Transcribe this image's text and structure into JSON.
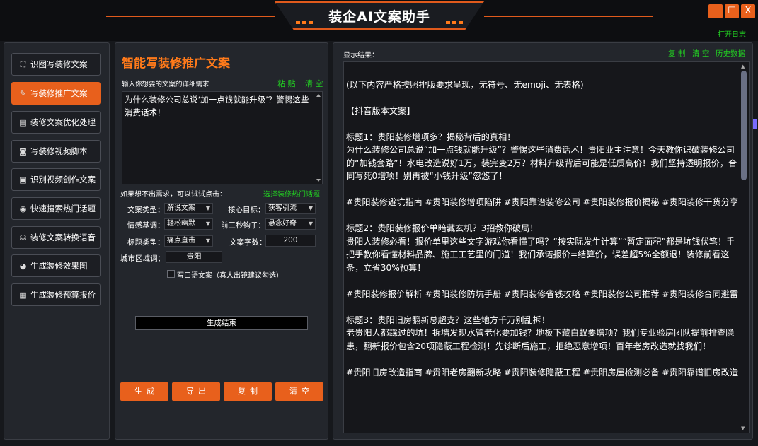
{
  "app": {
    "title": "装企AI文案助手",
    "open_log": "打开日志",
    "window_buttons": [
      "—",
      "☐",
      "X"
    ]
  },
  "sidebar": {
    "items": [
      {
        "label": "识图写装修文案",
        "icon": "image-scan-icon",
        "glyph": "⛶",
        "active": false
      },
      {
        "label": "写装修推广文案",
        "icon": "pen-icon",
        "glyph": "✎",
        "active": true
      },
      {
        "label": "装修文案优化处理",
        "icon": "document-icon",
        "glyph": "▤",
        "active": false
      },
      {
        "label": "写装修视频脚本",
        "icon": "camera-icon",
        "glyph": "◙",
        "active": false
      },
      {
        "label": "识别视频创作文案",
        "icon": "video-scan-icon",
        "glyph": "▣",
        "active": false
      },
      {
        "label": "快速搜索热门话题",
        "icon": "location-pin-icon",
        "glyph": "◉",
        "active": false
      },
      {
        "label": "装修文案转换语音",
        "icon": "headset-icon",
        "glyph": "☊",
        "active": false
      },
      {
        "label": "生成装修效果图",
        "icon": "palette-icon",
        "glyph": "◕",
        "active": false
      },
      {
        "label": "生成装修预算报价",
        "icon": "calculator-icon",
        "glyph": "▦",
        "active": false
      }
    ]
  },
  "middle": {
    "title": "智能写装修推广文案",
    "input_label": "输入你想要的文案的详细需求",
    "paste": "粘 贴",
    "clear_link": "清 空",
    "requirement": "为什么装修公司总说‘加一点钱就能升级’？警惕这些消费话术！",
    "hint": "如果想不出需求，可以试试点击：",
    "hot_topics": "选择装修热门话题",
    "fields": {
      "copy_type": {
        "label": "文案类型：",
        "value": "解说文案"
      },
      "goal": {
        "label": "核心目标：",
        "value": "获客引流"
      },
      "tone": {
        "label": "情感基调：",
        "value": "轻松幽默"
      },
      "hook": {
        "label": "前三秒钩子：",
        "value": "悬念好奇"
      },
      "title_type": {
        "label": "标题类型：",
        "value": "痛点直击"
      },
      "word_count": {
        "label": "文案字数：",
        "value": "200"
      },
      "city": {
        "label": "城市区域词：",
        "value": "贵阳"
      }
    },
    "colloquial": "写口语文案（真人出镜建议勾选）",
    "status": "生成结束",
    "buttons": {
      "generate": "生成",
      "export": "导出",
      "copy": "复制",
      "clear": "清空"
    }
  },
  "result": {
    "label": "显示结果：",
    "copy": "复 制",
    "clear": "清 空",
    "history": "历史数据",
    "paragraphs": [
      "",
      "  (以下内容严格按照排版要求呈现，无符号、无emoji、无表格)",
      "",
      "【抖音版本文案】",
      "",
      "标题1：贵阳装修增项多？揭秘背后的真相！",
      "为什么装修公司总说“加一点钱就能升级”？警惕这些消费话术！贵阳业主注意！今天教你识破装修公司的“加钱套路”！水电改造说好1万，装完变2万？材料升级背后可能是低质高价！我们坚持透明报价，合同写死0增项！别再被“小钱升级”忽悠了！",
      "",
      "#贵阳装修避坑指南 #贵阳装修增项陷阱 #贵阳靠谱装修公司 #贵阳装修报价揭秘 #贵阳装修干货分享",
      "",
      "标题2：贵阳装修报价单暗藏玄机？3招教你破局！",
      "贵阳人装修必看！报价单里这些文字游戏你看懂了吗？“按实际发生计算”“暂定面积”都是坑钱伏笔！手把手教你看懂材料品牌、施工工艺里的门道！我们承诺报价=结算价，误差超5%全额退！装修前看这条，立省30%预算！",
      "",
      "#贵阳装修报价解析 #贵阳装修防坑手册 #贵阳装修省钱攻略 #贵阳装修公司推荐 #贵阳装修合同避雷",
      "",
      "标题3：贵阳旧房翻新总超支？这些地方千万别乱拆！",
      "老贵阳人都踩过的坑！拆墙发现水管老化要加钱？地板下藏白蚁要增项？我们专业验房团队提前排查隐患，翻新报价包含20项隐蔽工程检测！先诊断后施工，拒绝恶意增项！百年老房改造就找我们！",
      "",
      "#贵阳旧房改造指南 #贵阳老房翻新攻略 #贵阳装修隐蔽工程 #贵阳房屋检测必备 #贵阳靠谱旧房改造"
    ]
  },
  "colors": {
    "accent": "#e8601c",
    "green": "#22cc22",
    "panel": "#23262c"
  }
}
